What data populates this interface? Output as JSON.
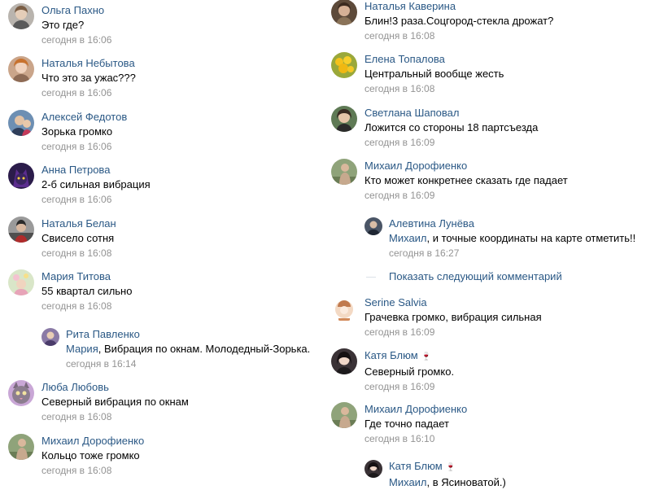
{
  "left_comments": [
    {
      "author": "Ольга Пахно",
      "text": "Это где?",
      "time": "сегодня в 16:06"
    },
    {
      "author": "Наталья Небытова",
      "text": "Что это за ужас???",
      "time": "сегодня в 16:06"
    },
    {
      "author": "Алексей Федотов",
      "text": "Зорька громко",
      "time": "сегодня в 16:06"
    },
    {
      "author": "Анна Петрова",
      "text": "2-б сильная вибрация",
      "time": "сегодня в 16:06"
    },
    {
      "author": "Наталья Белан",
      "text": "Свисело сотня",
      "time": "сегодня в 16:08"
    },
    {
      "author": "Мария Титова",
      "text": "55 квартал сильно",
      "time": "сегодня в 16:08"
    },
    {
      "author": "Рита Павленко",
      "mention": "Мария",
      "text": ", Вибрация по окнам. Молодедный-Зорька.",
      "time": "сегодня в 16:14"
    },
    {
      "author": "Люба Любовь",
      "text": "Северный вибрация по окнам",
      "time": "сегодня в 16:08"
    },
    {
      "author": "Михаил Дорофиенко",
      "text": "Кольцо тоже громко",
      "time": "сегодня в 16:08"
    }
  ],
  "right_comments": [
    {
      "author": "Наталья Каверина",
      "text": "Блин!3 раза.Соцгород-стекла дрожат?",
      "time": "сегодня в 16:08"
    },
    {
      "author": "Елена Топалова",
      "text": "Центральный вообще жесть",
      "time": "сегодня в 16:08"
    },
    {
      "author": "Светлана Шаповал",
      "text": "Ложится со стороны 18 партсъезда",
      "time": "сегодня в 16:09"
    },
    {
      "author": "Михаил Дорофиенко",
      "text": "Кто может конкретнее сказать где падает",
      "time": "сегодня в 16:09"
    },
    {
      "author": "Алевтина Лунёва",
      "mention": "Михаил",
      "text": ", и точные координаты на карте отметить!!",
      "time": "сегодня в 16:27"
    },
    {
      "author": "Serine Salvia",
      "text": "Грачевка громко, вибрация сильная",
      "time": "сегодня в 16:09"
    },
    {
      "author": "Катя Блюм",
      "text": "Северный громко.",
      "time": "сегодня в 16:09"
    },
    {
      "author": "Михаил Дорофиенко",
      "text": "Где точно падает",
      "time": "сегодня в 16:10"
    },
    {
      "author": "Катя Блюм",
      "mention": "Михаил",
      "text": ", в Ясиноватой.)",
      "time": ""
    }
  ],
  "show_next_comment": "Показать следующий комментарий",
  "wine_glass_glyph": "🍷",
  "colors": {
    "link": "#2a5885",
    "muted": "#939393",
    "text": "#000000"
  }
}
